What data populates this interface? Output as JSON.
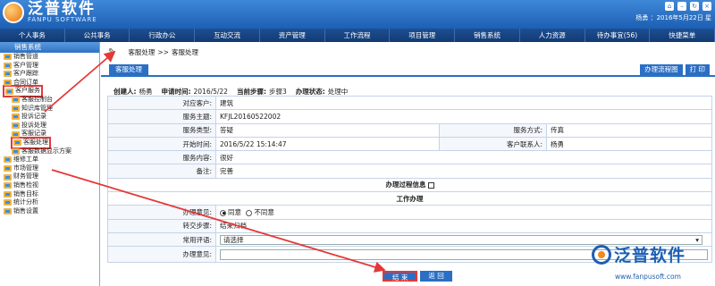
{
  "header": {
    "logo_title": "泛普软件",
    "logo_subtitle": "FANPU SOFTWARE",
    "user_info": "杨勇 ：2016年5月22日 星",
    "icons": [
      "home-icon",
      "minimize-icon",
      "refresh-icon",
      "close-icon"
    ]
  },
  "nav": [
    "个人事务",
    "公共事务",
    "行政办公",
    "互动交流",
    "资产管理",
    "工作流程",
    "项目管理",
    "销售系统",
    "人力资源",
    "待办事宜(56)",
    "快捷菜单"
  ],
  "sidebar": {
    "title": "销售系统",
    "items": [
      {
        "label": "销售管道",
        "level": 0
      },
      {
        "label": "客户管理",
        "level": 0
      },
      {
        "label": "客户跟踪",
        "level": 0
      },
      {
        "label": "合同订单",
        "level": 0
      },
      {
        "label": "客户服务",
        "level": 0,
        "highlight": true
      },
      {
        "label": "客服控制台",
        "level": 1
      },
      {
        "label": "知识库管理",
        "level": 1
      },
      {
        "label": "投诉记录",
        "level": 1
      },
      {
        "label": "投诉处理",
        "level": 1
      },
      {
        "label": "客服记录",
        "level": 1
      },
      {
        "label": "客服处理",
        "level": 1,
        "highlight": true
      },
      {
        "label": "客服数据显示方案",
        "level": 1
      },
      {
        "label": "维修工单",
        "level": 0
      },
      {
        "label": "市场管理",
        "level": 0
      },
      {
        "label": "财务管理",
        "level": 0
      },
      {
        "label": "销售检视",
        "level": 0
      },
      {
        "label": "销售目标",
        "level": 0
      },
      {
        "label": "统计分析",
        "level": 0
      },
      {
        "label": "销售设置",
        "level": 0
      }
    ]
  },
  "breadcrumb": {
    "part1": "客服处理",
    "sep": ">>",
    "part2": "客服处理"
  },
  "tab": {
    "label": "客服处理"
  },
  "tab_actions": [
    "办理流程图",
    "打 印"
  ],
  "info": {
    "creator_label": "创建人:",
    "creator": "杨勇",
    "time_label": "申请时间:",
    "time": "2016/5/22",
    "step_label": "当前步骤:",
    "step": "步骤3",
    "status_label": "办理状态:",
    "status": "处理中"
  },
  "form": {
    "customer_label": "对应客户:",
    "customer": "建筑",
    "subject_label": "服务主题:",
    "subject": "KFJL20160522002",
    "type_label": "服务类型:",
    "type": "答疑",
    "method_label": "服务方式:",
    "method": "传真",
    "start_label": "开始时间:",
    "start": "2016/5/22 15:14:47",
    "contact_label": "客户联系人:",
    "contact": "杨勇",
    "content_label": "服务内容:",
    "content": "很好",
    "remark_label": "备注:",
    "remark": "完善",
    "process_info": "办理过程信息",
    "work_handle": "工作办理",
    "opinion_label": "办理意见:",
    "agree": "同意",
    "disagree": "不同意",
    "transfer_label": "转交步骤:",
    "transfer": "结束归档",
    "common_label": "常用评语:",
    "common_placeholder": "请选择",
    "opinion2_label": "办理意见:",
    "opinion2_value": ""
  },
  "buttons": {
    "finish": "结 束",
    "back": "返 回"
  },
  "watermark": {
    "title": "泛普软件",
    "url": "www.fanpusoft.com"
  },
  "colors": {
    "brand": "#2a6fc4",
    "nav": "#1d4f93",
    "highlight": "#e43838"
  }
}
